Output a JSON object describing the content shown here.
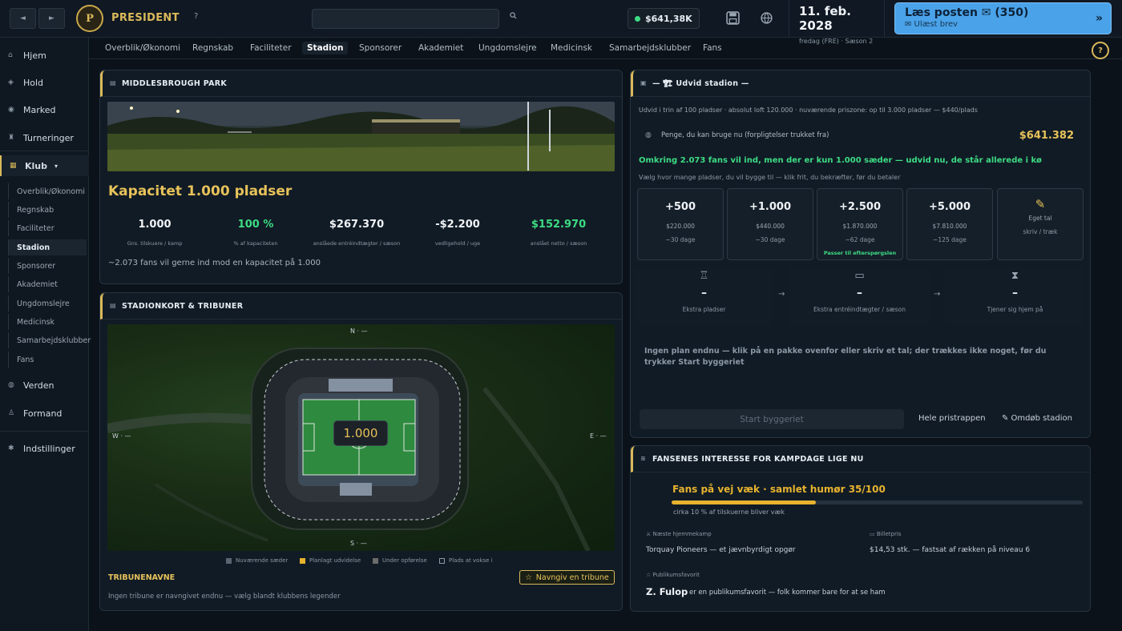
{
  "app": {
    "name": "PRESIDENT",
    "logo_letter": "P",
    "help": "?"
  },
  "topbar": {
    "back_icon": "◄",
    "forward_icon": "►",
    "search_placeholder": "",
    "balance": "$641,38K",
    "date": "11. feb. 2028",
    "date_sub": "fredag (FRE) · Sæson 2",
    "mail_title": "Læs posten ✉ (350)",
    "mail_sub": "✉ Ulæst brev",
    "mail_arrow": "»",
    "save_icon": "save-icon",
    "theme_icon": "theme-icon"
  },
  "sidebar": {
    "items": [
      {
        "label": "Hjem",
        "icon": "home-icon"
      },
      {
        "label": "Hold",
        "icon": "team-icon"
      },
      {
        "label": "Marked",
        "icon": "market-icon"
      },
      {
        "label": "Turneringer",
        "icon": "trophy-icon"
      },
      {
        "label": "Klub",
        "icon": "club-icon",
        "caret": "▾"
      },
      {
        "label": "Verden",
        "icon": "globe-icon"
      },
      {
        "label": "Formand",
        "icon": "chairman-icon"
      },
      {
        "label": "Indstillinger",
        "icon": "gear-icon"
      }
    ],
    "sub_items": [
      "Overblik/Økonomi",
      "Regnskab",
      "Faciliteter",
      "Stadion",
      "Sponsorer",
      "Akademiet",
      "Ungdomslejre",
      "Medicinsk",
      "Samarbejdsklubber",
      "Fans"
    ],
    "active_sub": "Stadion"
  },
  "tabs": [
    "Overblik/Økonomi",
    "Regnskab",
    "Faciliteter",
    "Stadion",
    "Sponsorer",
    "Akademiet",
    "Ungdomslejre",
    "Medicinsk",
    "Samarbejdsklubber",
    "Fans"
  ],
  "help_circle": "?",
  "park": {
    "title": "MIDDLESBROUGH PARK",
    "capacity_title": "Kapacitet 1.000 pladser",
    "stats": [
      {
        "value": "1.000",
        "label": "Gns. tilskuere / kamp",
        "color": "#f0f3f6"
      },
      {
        "value": "100 %",
        "label": "% af kapaciteten",
        "color": "#3ddc84"
      },
      {
        "value": "$267.370",
        "label": "anslåede entréindtægter / sæson",
        "color": "#f0f3f6"
      },
      {
        "value": "-$2.200",
        "label": "vedligehold / uge",
        "color": "#f0f3f6"
      },
      {
        "value": "$152.970",
        "label": "anslået netto / sæson",
        "color": "#3ddc84"
      }
    ],
    "demand_note": "~2.073 fans vil gerne ind mod en kapacitet på 1.000"
  },
  "stadium_map": {
    "title": "STADIONKORT & TRIBUNER",
    "capacity_label": "1.000",
    "compass": {
      "n": "N · —",
      "s": "S · —",
      "w": "W · —",
      "e": "E · —"
    },
    "legend": [
      {
        "label": "Nuværende sæder",
        "color": "#5a6571"
      },
      {
        "label": "Planlagt udvidelse",
        "color": "#e7b32f"
      },
      {
        "label": "Under opførelse",
        "color": "#6b6b6b"
      },
      {
        "label": "Plads at vokse i",
        "color": "transparent"
      }
    ],
    "stands_title": "TRIBUNENAVNE",
    "name_button": "Navngiv en tribune",
    "stands_note": "Ingen tribune er navngivet endnu — vælg blandt klubbens legender"
  },
  "expand": {
    "title": "— 🏗 Udvid stadion —",
    "intro": "Udvid i trin af 100 pladser · absolut loft 120.000 · nuværende priszone: op til 3.000 pladser — $440/plads",
    "funds_label": "Penge, du kan bruge nu (forpligtelser trukket fra)",
    "funds_value": "$641.382",
    "demand_msg": "Omkring 2.073 fans vil ind, men der er kun 1.000 sæder — udvid nu, de står allerede i kø",
    "choose_note": "Vælg hvor mange pladser, du vil bygge til — klik frit, du bekræfter, før du betaler",
    "packages": [
      {
        "size": "+500",
        "price": "$220.000",
        "duration": "~30 dage",
        "tag": ""
      },
      {
        "size": "+1.000",
        "price": "$440.000",
        "duration": "~30 dage",
        "tag": ""
      },
      {
        "size": "+2.500",
        "price": "$1.870.000",
        "duration": "~62 dage",
        "tag": "Passer til efterspørgslen"
      },
      {
        "size": "+5.000",
        "price": "$7.810.000",
        "duration": "~125 dage",
        "tag": ""
      }
    ],
    "custom": {
      "icon": "✎",
      "label": "Eget tal",
      "sub": "skriv / træk"
    },
    "flow": [
      {
        "icon": "chair-icon",
        "value": "–",
        "label": "Ekstra pladser"
      },
      {
        "icon": "ticket-icon",
        "value": "–",
        "label": "Ekstra entréindtægter / sæson"
      },
      {
        "icon": "hourglass-icon",
        "value": "–",
        "label": "Tjener sig hjem på"
      }
    ],
    "arrow": "→",
    "no_plan": "Ingen plan endnu — klik på en pakke ovenfor eller skriv et tal; der trækkes ikke noget, før du trykker Start byggeriet",
    "start_button": "Start byggeriet",
    "price_ladder": "Hele pristrappen",
    "rename": "✎ Omdøb stadion"
  },
  "fans": {
    "title": "FANSENES INTERESSE FOR KAMPDAGE LIGE NU",
    "mood_title": "Fans på vej væk · samlet humør 35/100",
    "mood": 35,
    "mood_note": "cirka 10 % af tilskuerne bliver væk",
    "next_match_label": "Næste hjemmekamp",
    "next_match": "Torquay Pioneers — et jævnbyrdigt opgør",
    "ticket_label": "Billetpris",
    "ticket": "$14,53 stk. — fastsat af rækken på niveau 6",
    "favorite_label": "Publikumsfavorit",
    "favorite_name": "Z. Fulop",
    "favorite_note": "er en publikumsfavorit — folk kommer bare for at se ham"
  }
}
